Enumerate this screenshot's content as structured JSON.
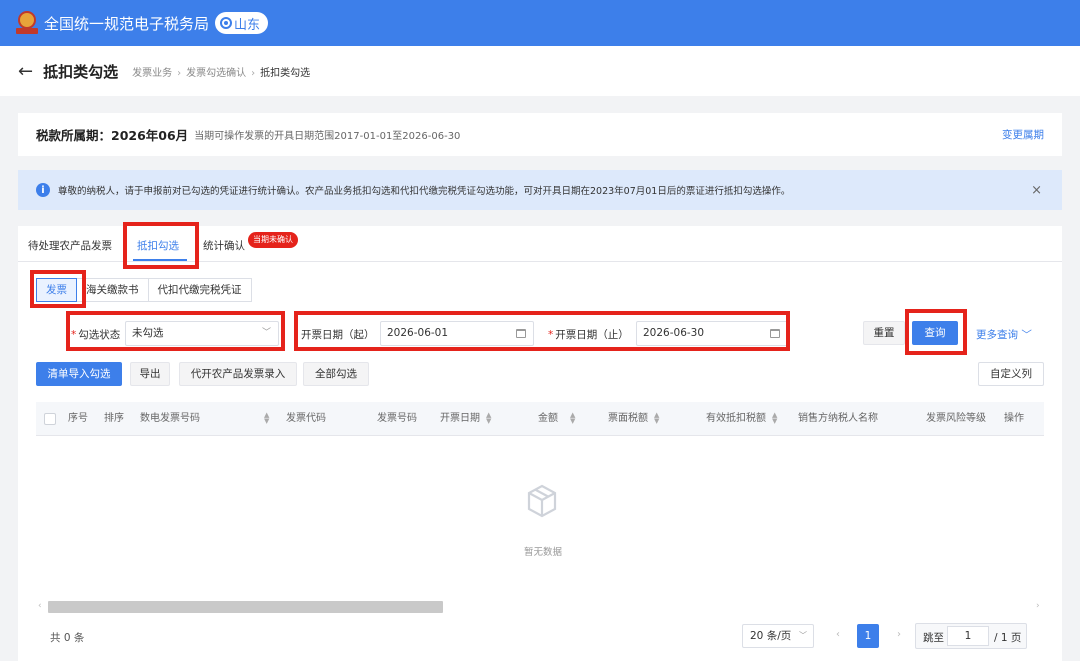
{
  "header": {
    "app_title": "全国统一规范电子税务局",
    "region": "山东",
    "brand_color": "#3d7fea"
  },
  "page": {
    "title": "抵扣类勾选",
    "breadcrumb": [
      "发票业务",
      "发票勾选确认",
      "抵扣类勾选"
    ]
  },
  "period": {
    "label": "税款所属期：2026年06月",
    "note": "当期可操作发票的开具日期范围2017-01-01至2026-06-30",
    "change_link": "变更属期"
  },
  "notice": {
    "text": "尊敬的纳税人，请于申报前对已勾选的凭证进行统计确认。农产品业务抵扣勾选和代扣代缴完税凭证勾选功能，可对开具日期在2023年07月01日后的票证进行抵扣勾选操作。",
    "close": "×"
  },
  "tabs": [
    {
      "label": "待处理农产品发票"
    },
    {
      "label": "抵扣勾选",
      "active": true
    },
    {
      "label": "统计确认"
    }
  ],
  "tab_badge": "当期未确认",
  "subtabs": [
    {
      "label": "发票",
      "active": true
    },
    {
      "label": "海关缴款书"
    },
    {
      "label": "代扣代缴完税凭证"
    }
  ],
  "filters": {
    "status_label": "勾选状态",
    "status_value": "未勾选",
    "start_label": "开票日期（起）",
    "start_value": "2026-06-01",
    "end_label": "开票日期（止）",
    "end_value": "2026-06-30",
    "reset": "重置",
    "query": "查询",
    "more": "更多查询"
  },
  "actions": {
    "import": "清单导入勾选",
    "export": "导出",
    "agri_entry": "代开农产品发票录入",
    "select_all": "全部勾选",
    "custom_columns": "自定义列"
  },
  "table": {
    "columns": [
      "序号",
      "排序",
      "数电发票号码",
      "发票代码",
      "发票号码",
      "开票日期",
      "金额",
      "票面税额",
      "有效抵扣税额",
      "销售方纳税人名称",
      "发票风险等级",
      "操作"
    ],
    "rows": [],
    "empty_text": "暂无数据"
  },
  "pagination": {
    "total": "共 0 条",
    "page_size": "20 条/页",
    "current_page": "1",
    "jump_label": "跳至",
    "jump_value": "1",
    "total_pages": "/ 1 页"
  }
}
